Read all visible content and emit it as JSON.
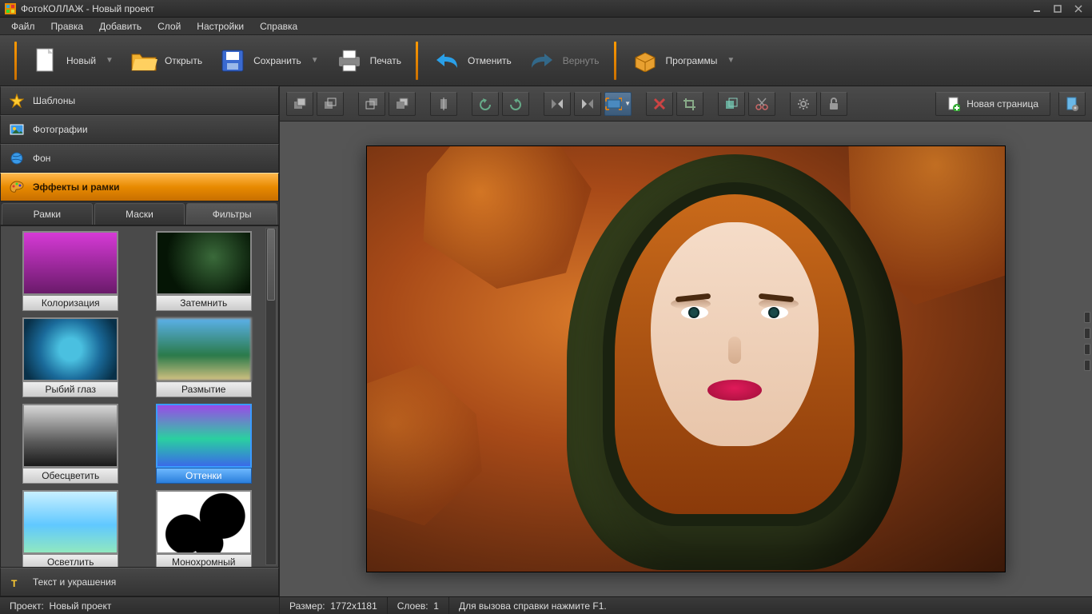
{
  "title": "ФотоКОЛЛАЖ - Новый проект",
  "menu": [
    "Файл",
    "Правка",
    "Добавить",
    "Слой",
    "Настройки",
    "Справка"
  ],
  "toolbar": {
    "new": "Новый",
    "open": "Открыть",
    "save": "Сохранить",
    "print": "Печать",
    "undo": "Отменить",
    "redo": "Вернуть",
    "programs": "Программы"
  },
  "accordion": {
    "templates": "Шаблоны",
    "photos": "Фотографии",
    "background": "Фон",
    "effects": "Эффекты и рамки",
    "text": "Текст и украшения"
  },
  "tabs": {
    "frames": "Рамки",
    "masks": "Маски",
    "filters": "Фильтры",
    "active": "filters"
  },
  "filters": [
    {
      "id": "colorize",
      "label": "Колоризация"
    },
    {
      "id": "darken",
      "label": "Затемнить"
    },
    {
      "id": "fisheye",
      "label": "Рыбий глаз"
    },
    {
      "id": "blur",
      "label": "Размытие"
    },
    {
      "id": "desat",
      "label": "Обесцветить"
    },
    {
      "id": "hue",
      "label": "Оттенки"
    },
    {
      "id": "light",
      "label": "Осветлить"
    },
    {
      "id": "mono",
      "label": "Монохромный"
    }
  ],
  "selected_filter": "hue",
  "newpage": "Новая страница",
  "status": {
    "project_lbl": "Проект:",
    "project": "Новый проект",
    "size_lbl": "Размер:",
    "size": "1772x1181",
    "layers_lbl": "Слоев:",
    "layers": "1",
    "help": "Для вызова справки нажмите F1."
  }
}
